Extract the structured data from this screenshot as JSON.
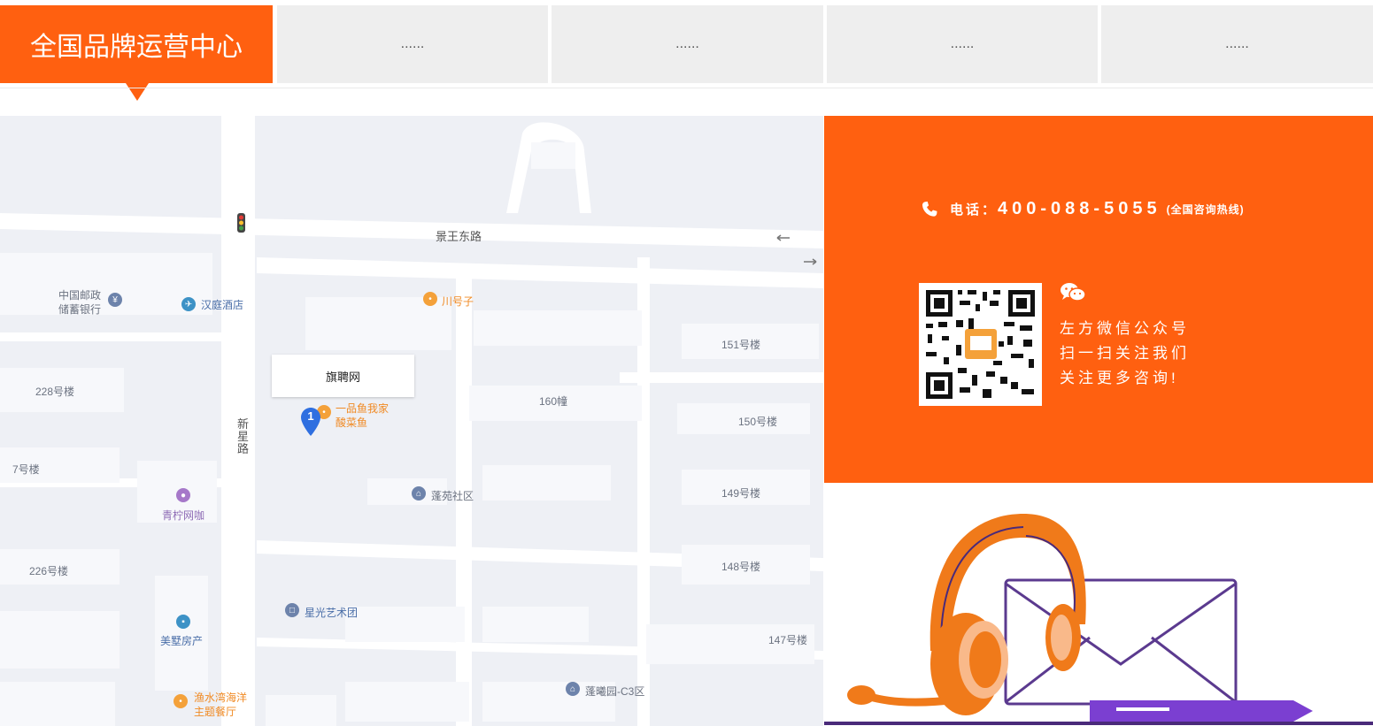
{
  "tabs": [
    {
      "label": "全国品牌运营中心",
      "active": true
    },
    {
      "label": "......",
      "active": false
    },
    {
      "label": "......",
      "active": false
    },
    {
      "label": "......",
      "active": false
    },
    {
      "label": "......",
      "active": false
    }
  ],
  "map": {
    "callout": "旗聘网",
    "marker_number": "1",
    "roads": {
      "east_west": "景王东路",
      "north_south_1": "新",
      "north_south_2": "星",
      "north_south_3": "路"
    },
    "labels": {
      "post_bank_1": "中国邮政",
      "post_bank_2": "储蓄银行",
      "hanting": "汉庭酒店",
      "chuanhaozi": "川号子",
      "b151": "151号楼",
      "b228": "228号楼",
      "b160": "160幢",
      "b150": "150号楼",
      "yipinyu_1": "一品鱼我家",
      "yipinyu_2": "酸菜鱼",
      "b7": "7号楼",
      "pengyuan": "蓬苑社区",
      "b149": "149号楼",
      "qingning": "青柠网咖",
      "b226": "226号楼",
      "b148": "148号楼",
      "xingguang": "星光艺术团",
      "meishu": "美墅房产",
      "b147": "147号楼",
      "yushuiwan_1": "渔水湾海洋",
      "yushuiwan_2": "主题餐厅",
      "pengxi": "蓬曦园-C3区"
    }
  },
  "contact": {
    "phone_label": "电话：",
    "phone_number": "400-088-5055",
    "phone_note": "(全国咨询热线)",
    "wechat_lines": [
      "左方微信公众号",
      "扫一扫关注我们",
      "关注更多咨询!"
    ]
  },
  "colors": {
    "accent": "#ff6010",
    "tab_bg": "#eeeeee",
    "map_bg": "#eef0f5",
    "illustration_purple": "#5b3a8f"
  },
  "icons": {
    "phone": "phone-icon",
    "wechat": "wechat-icon",
    "qr": "qr-code",
    "headset": "headset-icon",
    "envelope": "envelope-icon"
  }
}
